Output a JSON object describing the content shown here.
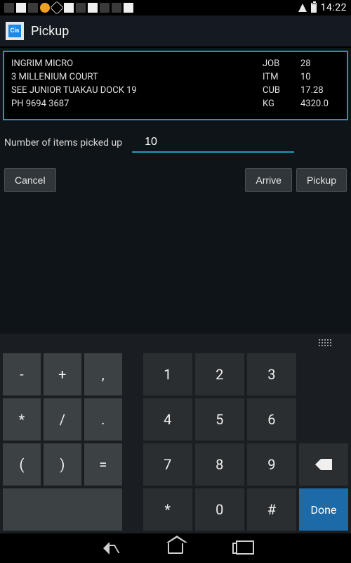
{
  "status_bar": {
    "time": "14:22"
  },
  "action_bar": {
    "icon_text": "Cis",
    "title": "Pickup"
  },
  "job": {
    "line1": "INGRIM MICRO",
    "line2": "3 MILLENIUM  COURT",
    "line3": "SEE JUNIOR TUAKAU DOCK 19",
    "line4": "PH 9694 3687",
    "metrics": {
      "job_label": "JOB",
      "job_value": "28",
      "itm_label": "ITM",
      "itm_value": "10",
      "cub_label": "CUB",
      "cub_value": "17.28",
      "kg_label": "KG",
      "kg_value": "4320.0"
    }
  },
  "input": {
    "label": "Number of items picked up",
    "value": "10"
  },
  "buttons": {
    "cancel": "Cancel",
    "arrive": "Arrive",
    "pickup": "Pickup"
  },
  "keyboard": {
    "sym_minus": "-",
    "sym_plus": "+",
    "sym_comma": ",",
    "sym_star": "*",
    "sym_slash": "/",
    "sym_dot": ".",
    "sym_lparen": "(",
    "sym_rparen": ")",
    "sym_eq": "=",
    "sym_star2": "*",
    "sym_hash": "#",
    "k1": "1",
    "k2": "2",
    "k3": "3",
    "k4": "4",
    "k5": "5",
    "k6": "6",
    "k7": "7",
    "k8": "8",
    "k9": "9",
    "k0": "0",
    "done": "Done"
  }
}
